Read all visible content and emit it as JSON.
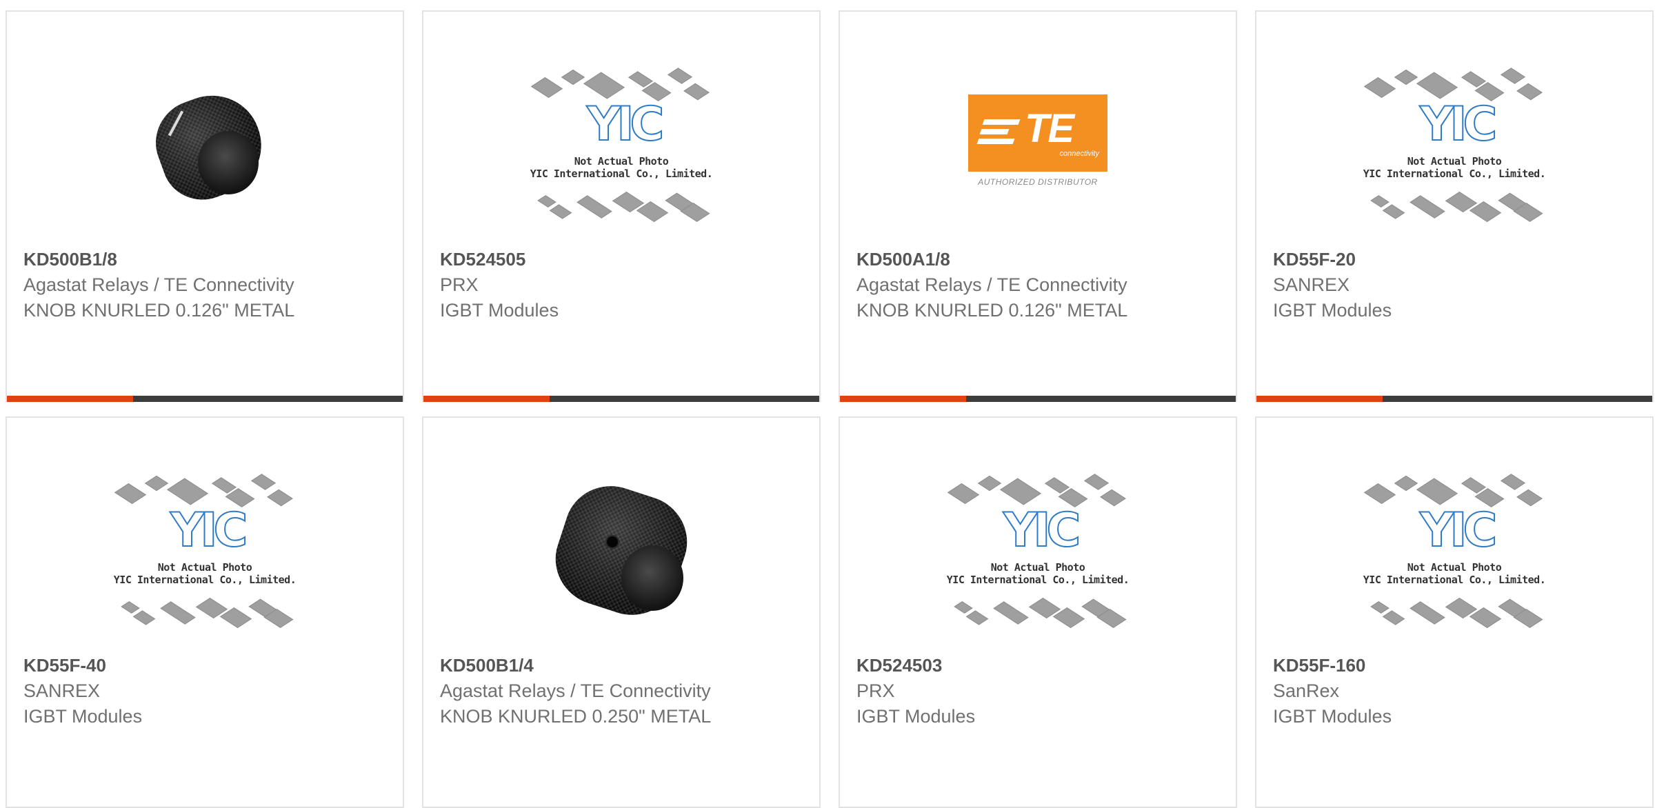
{
  "placeholder": {
    "line1": "Not Actual Photo",
    "line2": "YIC International Co., Limited."
  },
  "te_logo": {
    "wordmark": "TE",
    "tagline": "connectivity",
    "badge": "AUTHORIZED DISTRIBUTOR"
  },
  "accent_color": "#e5410e",
  "products": [
    {
      "part_number": "KD500B1/8",
      "manufacturer": "Agastat Relays / TE Connectivity",
      "description": "KNOB KNURLED 0.126\" METAL",
      "image": "knob-photo"
    },
    {
      "part_number": "KD524505",
      "manufacturer": "PRX",
      "description": "IGBT Modules",
      "image": "yic-placeholder"
    },
    {
      "part_number": "KD500A1/8",
      "manufacturer": "Agastat Relays / TE Connectivity",
      "description": "KNOB KNURLED 0.126\" METAL",
      "image": "te-logo"
    },
    {
      "part_number": "KD55F-20",
      "manufacturer": "SANREX",
      "description": "IGBT Modules",
      "image": "yic-placeholder"
    },
    {
      "part_number": "KD55F-40",
      "manufacturer": "SANREX",
      "description": "IGBT Modules",
      "image": "yic-placeholder"
    },
    {
      "part_number": "KD500B1/4",
      "manufacturer": "Agastat Relays / TE Connectivity",
      "description": "KNOB KNURLED 0.250\" METAL",
      "image": "knob-photo"
    },
    {
      "part_number": "KD524503",
      "manufacturer": "PRX",
      "description": "IGBT Modules",
      "image": "yic-placeholder"
    },
    {
      "part_number": "KD55F-160",
      "manufacturer": "SanRex",
      "description": "IGBT Modules",
      "image": "yic-placeholder"
    }
  ]
}
